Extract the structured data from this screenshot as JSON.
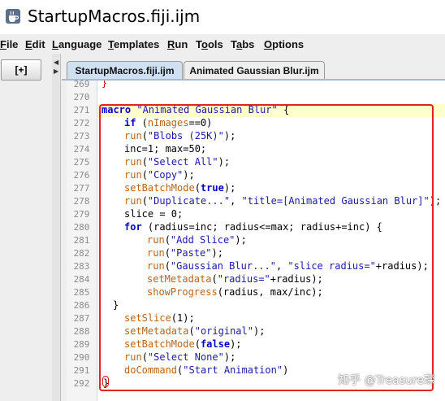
{
  "window": {
    "title": "StartupMacros.fiji.ijm",
    "icon": "coffee-cup-icon"
  },
  "menubar": {
    "items": [
      {
        "mnemonic": "F",
        "rest": "ile"
      },
      {
        "mnemonic": "E",
        "rest": "dit"
      },
      {
        "mnemonic": "L",
        "rest": "anguage"
      },
      {
        "mnemonic": "T",
        "rest": "emplates"
      },
      {
        "mnemonic": "R",
        "rest": "un"
      },
      {
        "mnemonic": "",
        "pre": "T",
        "mid": "o",
        "post": "ols"
      },
      {
        "mnemonic": "",
        "pre": "T",
        "mid": "a",
        "post": "bs"
      },
      {
        "mnemonic": "O",
        "rest": "ptions"
      }
    ]
  },
  "left_panel": {
    "expand_label": "[+]"
  },
  "tabs": [
    {
      "label": "StartupMacros.fiji.ijm",
      "active": true
    },
    {
      "label": "Animated Gaussian Blur.ijm",
      "active": false
    }
  ],
  "editor": {
    "line_numbers": [
      "269",
      "270",
      "271",
      "272",
      "273",
      "274",
      "275",
      "276",
      "277",
      "278",
      "279",
      "280",
      "281",
      "282",
      "283",
      "284",
      "285",
      "286",
      "287",
      "288",
      "289",
      "290",
      "291",
      "292"
    ],
    "top_line_fragment": "}",
    "lines": {
      "l271_kw": "macro",
      "l271_str": "\"Animated Gaussian Blur\"",
      "l271_end": " {",
      "l272_kw": "if",
      "l272_a": " (",
      "l272_fn": "nImages",
      "l272_b": "==0)",
      "l273_fn": "run",
      "l273_a": "(",
      "l273_str": "\"Blobs (25K)\"",
      "l273_b": ");",
      "l274_text": "inc=1; max=50;",
      "l275_fn": "run",
      "l275_a": "(",
      "l275_str": "\"Select All\"",
      "l275_b": ");",
      "l276_fn": "run",
      "l276_a": "(",
      "l276_str": "\"Copy\"",
      "l276_b": ");",
      "l277_fn": "setBatchMode",
      "l277_a": "(",
      "l277_kw": "true",
      "l277_b": ");",
      "l278_fn": "run",
      "l278_a": "(",
      "l278_str1": "\"Duplicate...\"",
      "l278_c": ", ",
      "l278_str2": "\"title=[Animated Gaussian Blur]\"",
      "l278_b": ");",
      "l279_text": "slice = 0;",
      "l280_kw": "for",
      "l280_text": " (radius=inc; radius<=max; radius+=inc) {",
      "l281_fn": "run",
      "l281_a": "(",
      "l281_str": "\"Add Slice\"",
      "l281_b": ");",
      "l282_fn": "run",
      "l282_a": "(",
      "l282_str": "\"Paste\"",
      "l282_b": ");",
      "l283_fn": "run",
      "l283_a": "(",
      "l283_str1": "\"Gaussian Blur...\"",
      "l283_c": ", ",
      "l283_str2": "\"slice radius=\"",
      "l283_b": "+radius);",
      "l284_fn": "setMetadata",
      "l284_a": "(",
      "l284_str": "\"radius=\"",
      "l284_b": "+radius);",
      "l285_fn": "showProgress",
      "l285_text": "(radius, max/inc);",
      "l286_text": "}",
      "l287_fn": "setSlice",
      "l287_text": "(1);",
      "l288_fn": "setMetadata",
      "l288_a": "(",
      "l288_str": "\"original\"",
      "l288_b": ");",
      "l289_fn": "setBatchMode",
      "l289_a": "(",
      "l289_kw": "false",
      "l289_b": ");",
      "l290_fn": "run",
      "l290_a": "(",
      "l290_str": "\"Select None\"",
      "l290_b": ");",
      "l291_fn": "doCommand",
      "l291_a": "(",
      "l291_str": "\"Start Animation\"",
      "l291_b": ")",
      "l292_text": "}"
    }
  },
  "watermark": "知乎 @Treasure琛",
  "colors": {
    "highlight_box": "#e0241f",
    "current_line": "#ffffcc",
    "active_tab": "#cfe0f3",
    "keyword": "#0000cc",
    "function": "#b5651d"
  }
}
